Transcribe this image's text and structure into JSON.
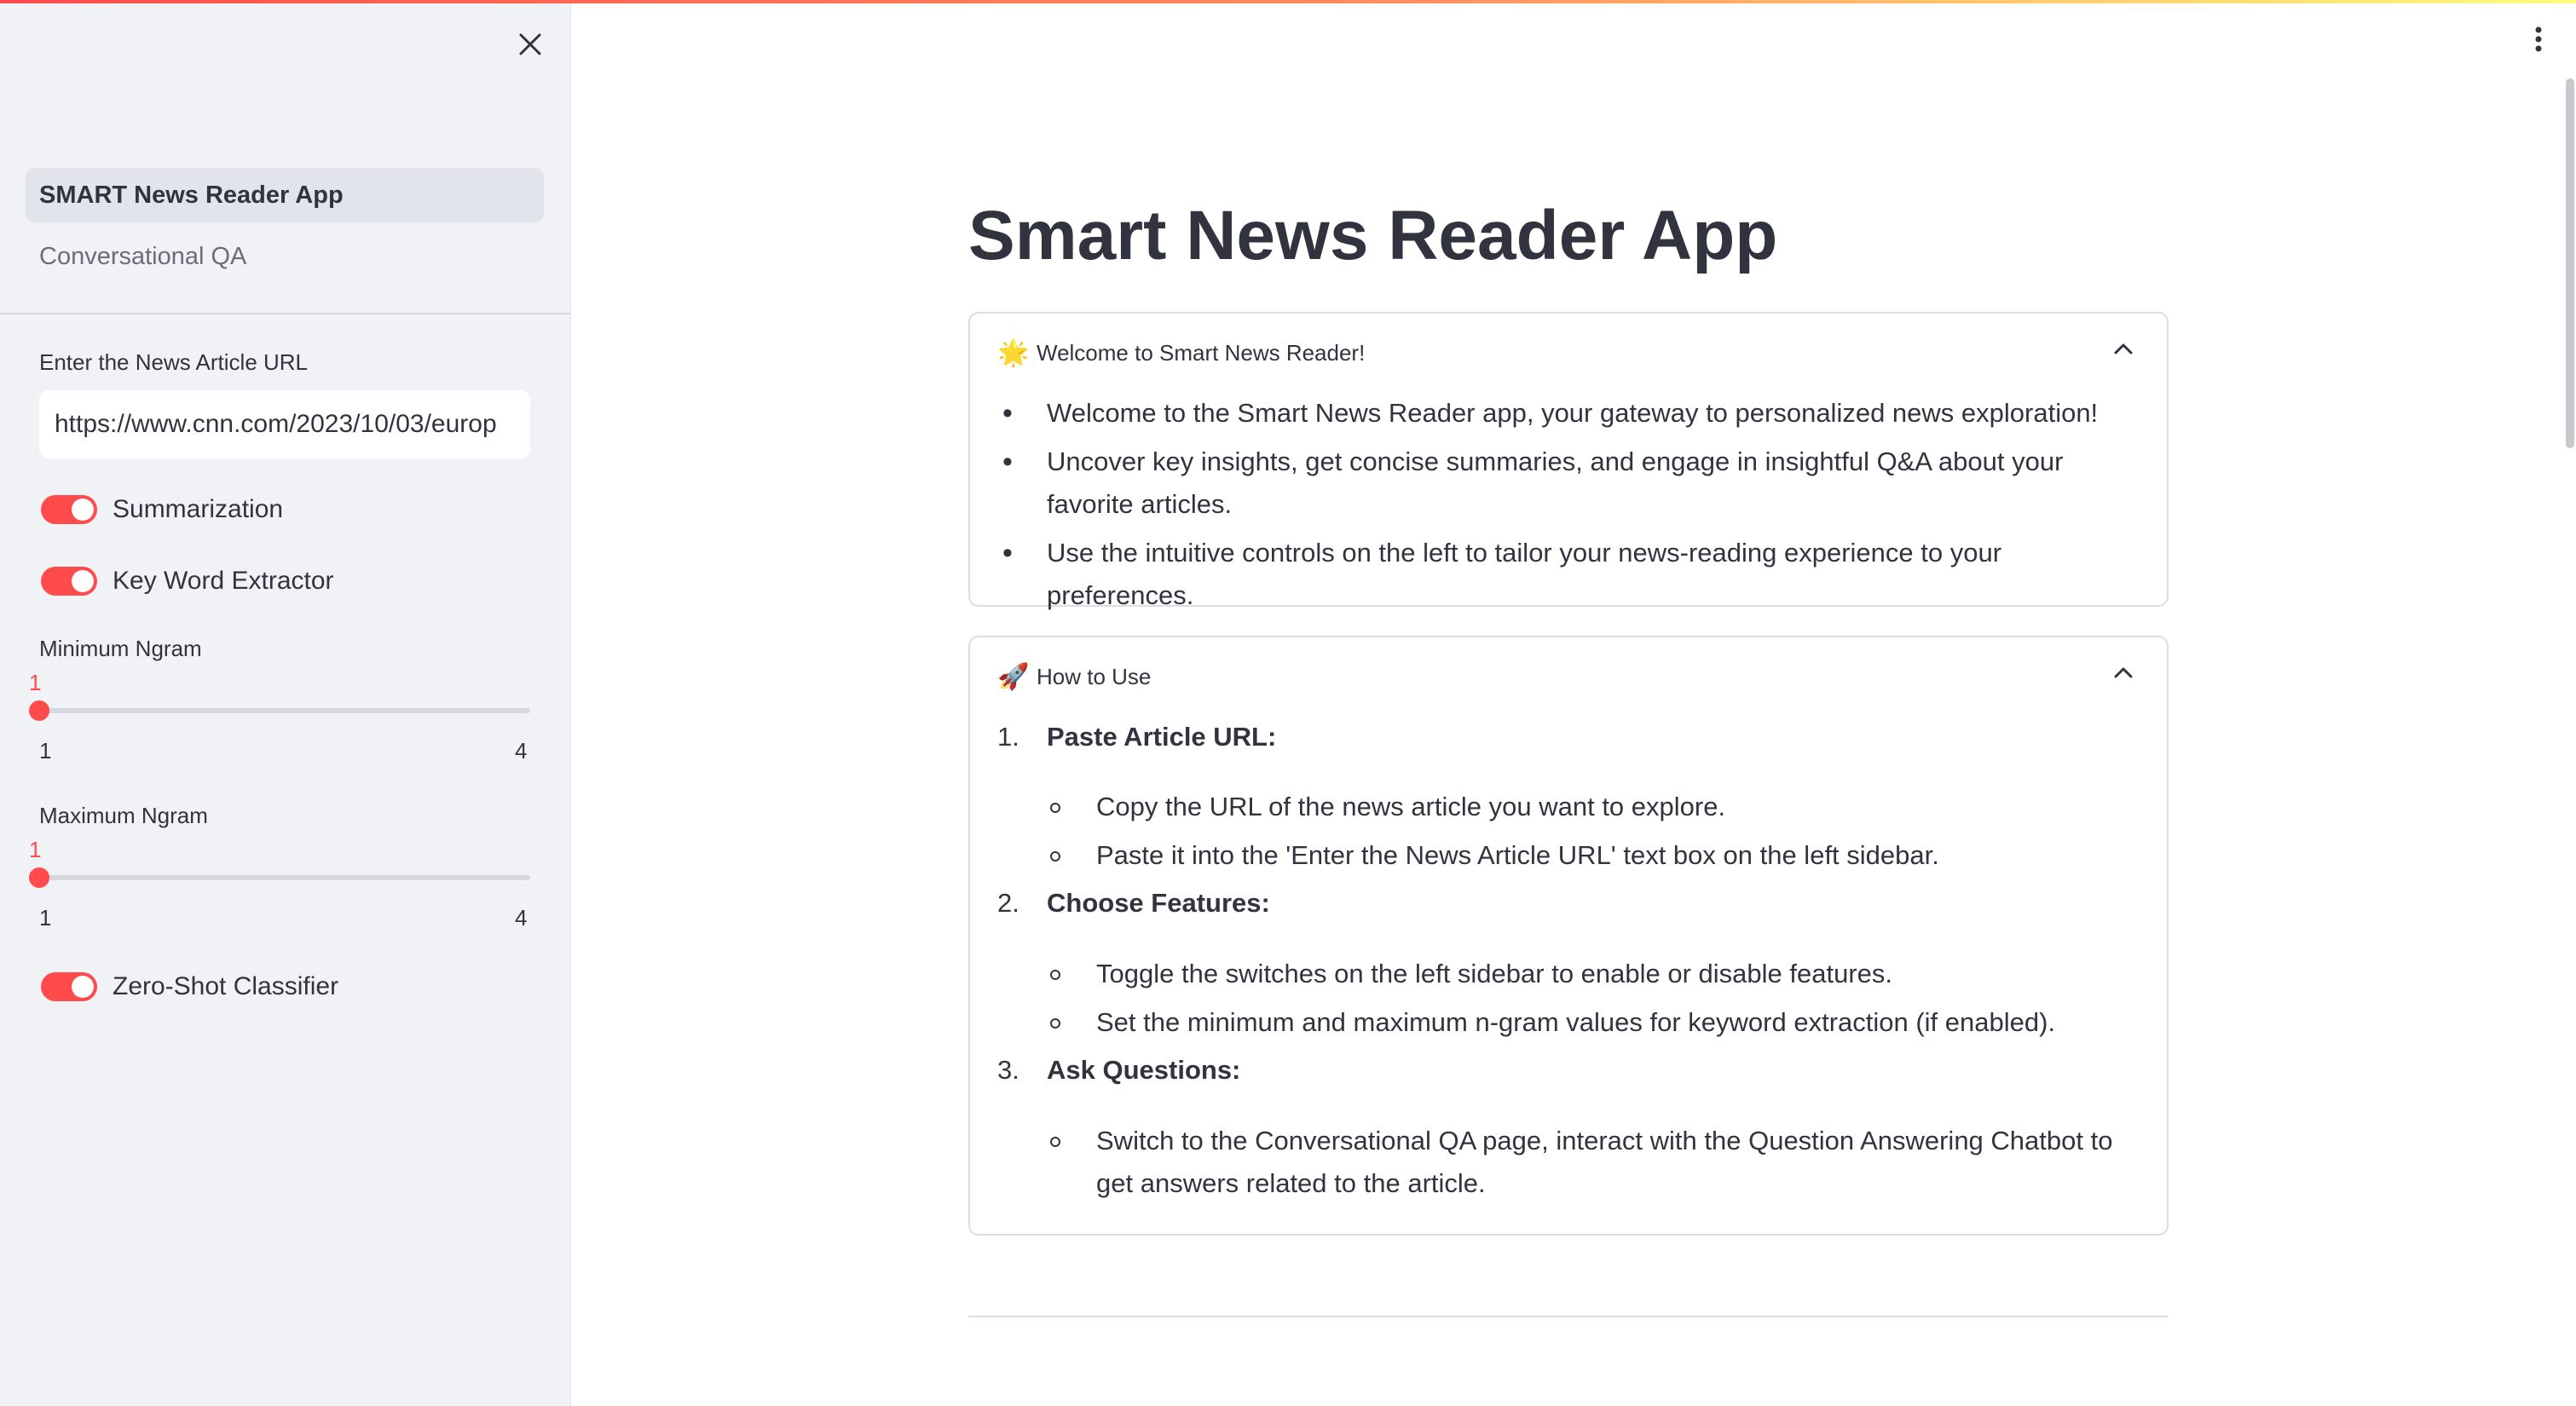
{
  "sidebar": {
    "nav": [
      {
        "label": "SMART News Reader App",
        "active": true
      },
      {
        "label": "Conversational QA",
        "active": false
      }
    ],
    "url_label": "Enter the News Article URL",
    "url_value": "https://www.cnn.com/2023/10/03/europ",
    "toggles": {
      "summarization": {
        "label": "Summarization",
        "on": true
      },
      "keyword": {
        "label": "Key Word Extractor",
        "on": true
      },
      "zeroshot": {
        "label": "Zero-Shot Classifier",
        "on": true
      }
    },
    "sliders": {
      "min_ngram": {
        "label": "Minimum Ngram",
        "value": "1",
        "min": "1",
        "max": "4"
      },
      "max_ngram": {
        "label": "Maximum Ngram",
        "value": "1",
        "min": "1",
        "max": "4"
      }
    }
  },
  "main": {
    "title": "Smart News Reader App",
    "welcome": {
      "emoji": "🌟",
      "title": "Welcome to Smart News Reader!",
      "bullets": [
        "Welcome to the Smart News Reader app, your gateway to personalized news exploration!",
        "Uncover key insights, get concise summaries, and engage in insightful Q&A about your favorite articles.",
        "Use the intuitive controls on the left to tailor your news-reading experience to your preferences."
      ]
    },
    "howto": {
      "emoji": "🚀",
      "title": "How to Use",
      "steps": [
        {
          "num": "1.",
          "title": "Paste Article URL:",
          "items": [
            "Copy the URL of the news article you want to explore.",
            "Paste it into the 'Enter the News Article URL' text box on the left sidebar."
          ]
        },
        {
          "num": "2.",
          "title": "Choose Features:",
          "items": [
            "Toggle the switches on the left sidebar to enable or disable features.",
            "Set the minimum and maximum n-gram values for keyword extraction (if enabled)."
          ]
        },
        {
          "num": "3.",
          "title": "Ask Questions:",
          "items": [
            "Switch to the Conversational QA page, interact with the Question Answering Chatbot to get answers related to the article."
          ]
        }
      ]
    }
  },
  "colors": {
    "accent": "#ff4b4b",
    "sidebar_bg": "#f0f2f6",
    "text": "#31333f"
  },
  "icons": [
    "close-icon",
    "more-vertical-icon",
    "chevron-up-icon",
    "star-icon",
    "rocket-icon"
  ]
}
